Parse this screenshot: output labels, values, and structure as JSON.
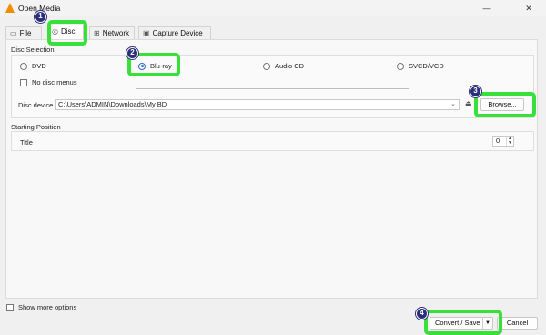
{
  "window": {
    "title": "Open Media",
    "minimize": "—",
    "close": "✕"
  },
  "tabs": [
    {
      "label": "File",
      "icon": "file-icon"
    },
    {
      "label": "Disc",
      "icon": "disc-icon"
    },
    {
      "label": "Network",
      "icon": "network-icon"
    },
    {
      "label": "Capture Device",
      "icon": "capture-device-icon"
    }
  ],
  "disc_selection": {
    "title": "Disc Selection",
    "options": [
      {
        "label": "DVD",
        "selected": false
      },
      {
        "label": "Blu-ray",
        "selected": true
      },
      {
        "label": "Audio CD",
        "selected": false
      },
      {
        "label": "SVCD/VCD",
        "selected": false
      }
    ],
    "no_disc_menus": {
      "label": "No disc menus",
      "checked": false
    },
    "disc_device_label": "Disc device",
    "disc_device_value": "C:\\Users\\ADMIN\\Downloads\\My BD",
    "browse_label": "Browse..."
  },
  "starting_position": {
    "title": "Starting Position",
    "title_label": "Title",
    "title_value": "0"
  },
  "footer": {
    "show_more_options": "Show more options",
    "convert_save": "Convert / Save",
    "cancel": "Cancel"
  },
  "annotations": {
    "color": "#39e039",
    "badges": [
      "1",
      "2",
      "3",
      "4"
    ]
  }
}
